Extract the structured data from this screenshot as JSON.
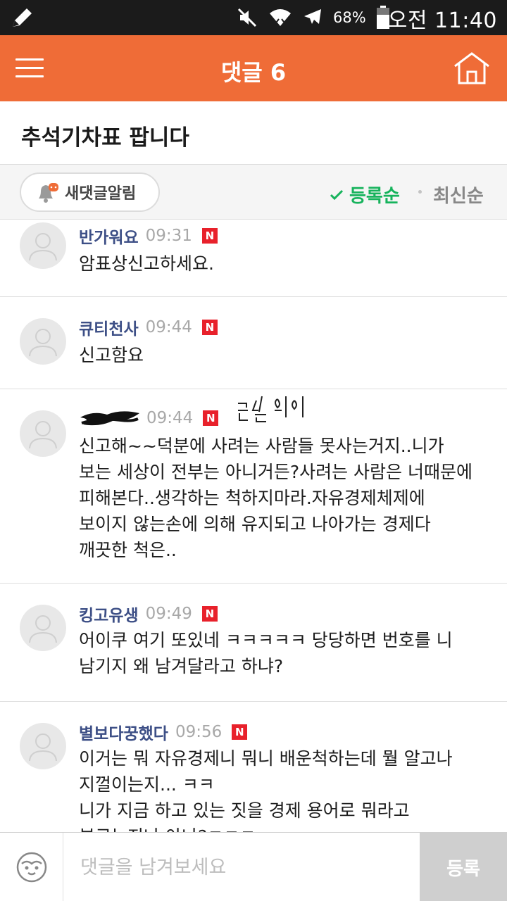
{
  "status_bar": {
    "battery_percent": "68%",
    "time": "오전 11:40",
    "icons": [
      "pen-icon",
      "mute-icon",
      "wifi-icon",
      "airplane-icon",
      "battery-icon"
    ]
  },
  "header": {
    "title": "댓글 6",
    "accent_color": "#ef6c37",
    "icons": [
      "menu-icon",
      "home-icon"
    ]
  },
  "post": {
    "title": "추석기차표 팝니다"
  },
  "sort_bar": {
    "alarm_label": "새댓글알림",
    "sort_registered": "등록순",
    "sort_latest": "최신순",
    "active_sort": "등록순",
    "active_color": "#16b35c"
  },
  "comments": [
    {
      "nickname": "반가워요",
      "time": "09:31",
      "badge": "N",
      "text": "암표상신고하세요."
    },
    {
      "nickname": "큐티천사",
      "time": "09:44",
      "badge": "N",
      "text": "신고함요"
    },
    {
      "nickname": "",
      "time": "09:44",
      "badge": "N",
      "annotation": "글쓴이",
      "text": "신고해~~덕분에 사려는 사람들 못사는거지..니가 보는 세상이 전부는 아니거든?사려는 사람은 너때문에 피해본다..생각하는 척하지마라.자유경제체제에 보이지 않는손에 의해 유지되고 나아가는 경제다 깨끗한 척은.."
    },
    {
      "nickname": "킹고유생",
      "time": "09:49",
      "badge": "N",
      "text": "어이쿠 여기 또있네 ㅋㅋㅋㅋㅋ 당당하면 번호를 니 남기지 왜 남겨달라고 하냐?"
    },
    {
      "nickname": "별보다꿍했다",
      "time": "09:56",
      "badge": "N",
      "text": "이거는 뭐 자유경제니 뭐니 배운척하는데 뭘 알고나 지껄이는지... ㅋㅋ\n니가 지금 하고 있는 짓을 경제 용어로 뭐라고 부르는지나 아냐?ㅋㅋㅋ"
    }
  ],
  "input_bar": {
    "placeholder": "댓글을 남겨보세요",
    "value": "",
    "submit_label": "등록"
  }
}
